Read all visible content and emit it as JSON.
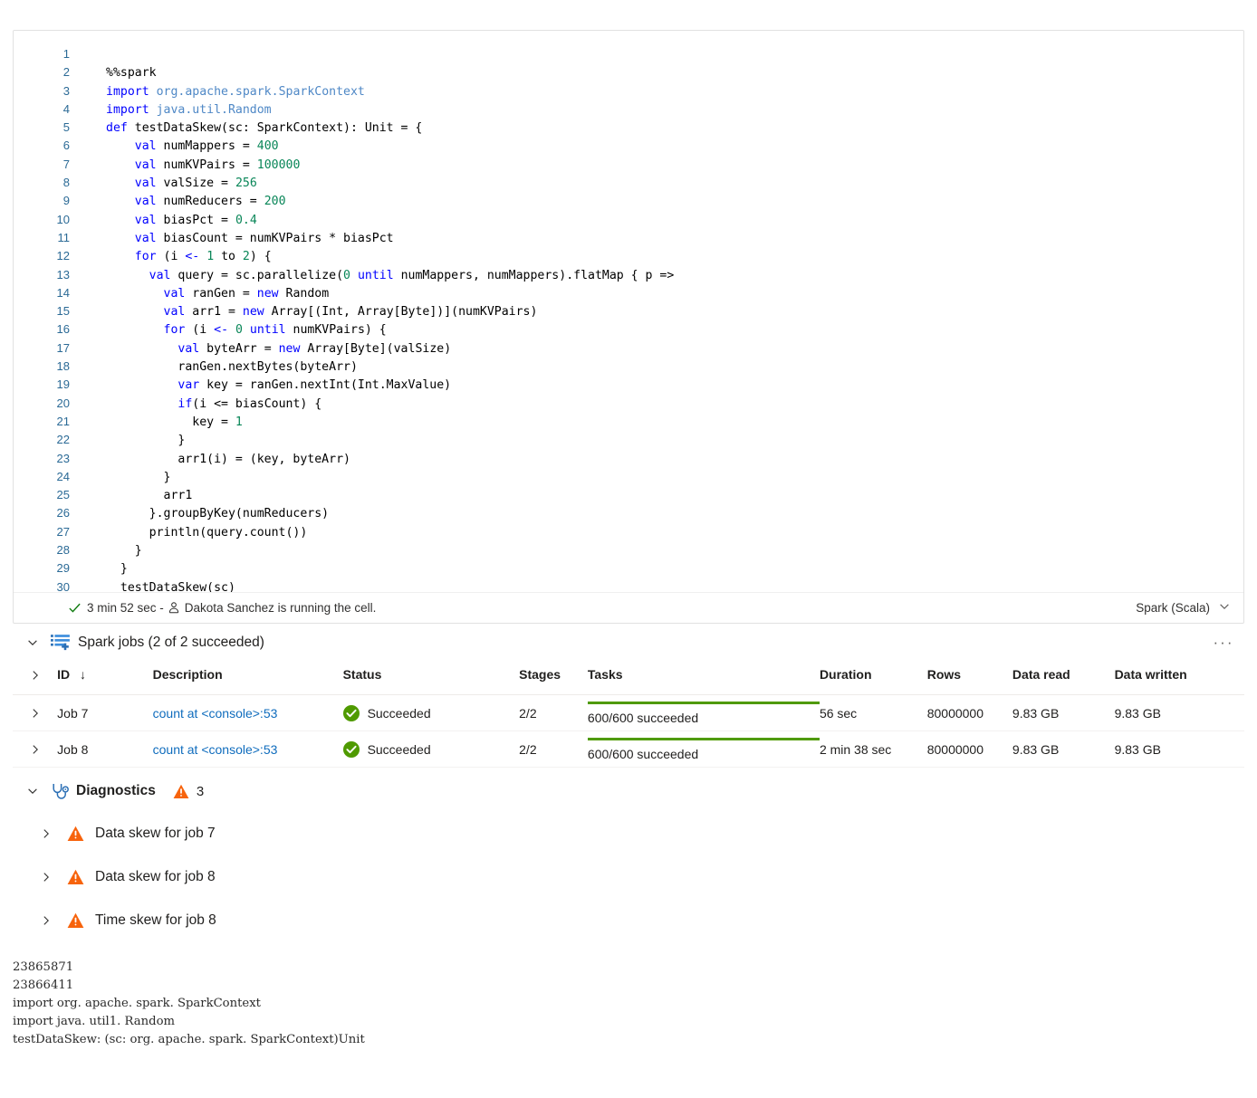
{
  "cell": {
    "code_lines": [
      {
        "n": "1",
        "tokens": []
      },
      {
        "n": "2",
        "tokens": [
          {
            "t": "%%spark",
            "c": "plain"
          }
        ]
      },
      {
        "n": "3",
        "tokens": [
          {
            "t": "import",
            "c": "kw"
          },
          {
            "t": " ",
            "c": "plain"
          },
          {
            "t": "org.apache.spark.SparkContext",
            "c": "pkg"
          }
        ]
      },
      {
        "n": "4",
        "tokens": [
          {
            "t": "import",
            "c": "kw"
          },
          {
            "t": " ",
            "c": "plain"
          },
          {
            "t": "java.util.Random",
            "c": "pkg"
          }
        ]
      },
      {
        "n": "5",
        "tokens": [
          {
            "t": "def",
            "c": "kw"
          },
          {
            "t": " testDataSkew(sc: SparkContext): Unit = {",
            "c": "plain"
          }
        ]
      },
      {
        "n": "6",
        "tokens": [
          {
            "t": "    ",
            "c": "plain"
          },
          {
            "t": "val",
            "c": "kw"
          },
          {
            "t": " numMappers = ",
            "c": "plain"
          },
          {
            "t": "400",
            "c": "num"
          }
        ]
      },
      {
        "n": "7",
        "tokens": [
          {
            "t": "    ",
            "c": "plain"
          },
          {
            "t": "val",
            "c": "kw"
          },
          {
            "t": " numKVPairs = ",
            "c": "plain"
          },
          {
            "t": "100000",
            "c": "num"
          }
        ]
      },
      {
        "n": "8",
        "tokens": [
          {
            "t": "    ",
            "c": "plain"
          },
          {
            "t": "val",
            "c": "kw"
          },
          {
            "t": " valSize = ",
            "c": "plain"
          },
          {
            "t": "256",
            "c": "num"
          }
        ]
      },
      {
        "n": "9",
        "tokens": [
          {
            "t": "    ",
            "c": "plain"
          },
          {
            "t": "val",
            "c": "kw"
          },
          {
            "t": " numReducers = ",
            "c": "plain"
          },
          {
            "t": "200",
            "c": "num"
          }
        ]
      },
      {
        "n": "10",
        "tokens": [
          {
            "t": "    ",
            "c": "plain"
          },
          {
            "t": "val",
            "c": "kw"
          },
          {
            "t": " biasPct = ",
            "c": "plain"
          },
          {
            "t": "0.4",
            "c": "num"
          }
        ]
      },
      {
        "n": "11",
        "tokens": [
          {
            "t": "    ",
            "c": "plain"
          },
          {
            "t": "val",
            "c": "kw"
          },
          {
            "t": " biasCount = numKVPairs * biasPct",
            "c": "plain"
          }
        ]
      },
      {
        "n": "12",
        "tokens": [
          {
            "t": "    ",
            "c": "plain"
          },
          {
            "t": "for",
            "c": "kw"
          },
          {
            "t": " (i ",
            "c": "plain"
          },
          {
            "t": "<-",
            "c": "kw"
          },
          {
            "t": " ",
            "c": "plain"
          },
          {
            "t": "1",
            "c": "num"
          },
          {
            "t": " to ",
            "c": "plain"
          },
          {
            "t": "2",
            "c": "num"
          },
          {
            "t": ") {",
            "c": "plain"
          }
        ]
      },
      {
        "n": "13",
        "tokens": [
          {
            "t": "      ",
            "c": "plain"
          },
          {
            "t": "val",
            "c": "kw"
          },
          {
            "t": " query = sc.parallelize(",
            "c": "plain"
          },
          {
            "t": "0",
            "c": "num"
          },
          {
            "t": " ",
            "c": "plain"
          },
          {
            "t": "until",
            "c": "kw"
          },
          {
            "t": " numMappers, numMappers).flatMap { p =>",
            "c": "plain"
          }
        ]
      },
      {
        "n": "14",
        "tokens": [
          {
            "t": "        ",
            "c": "plain"
          },
          {
            "t": "val",
            "c": "kw"
          },
          {
            "t": " ranGen = ",
            "c": "plain"
          },
          {
            "t": "new",
            "c": "kw"
          },
          {
            "t": " Random",
            "c": "plain"
          }
        ]
      },
      {
        "n": "15",
        "tokens": [
          {
            "t": "        ",
            "c": "plain"
          },
          {
            "t": "val",
            "c": "kw"
          },
          {
            "t": " arr1 = ",
            "c": "plain"
          },
          {
            "t": "new",
            "c": "kw"
          },
          {
            "t": " Array[(Int, Array[Byte])](numKVPairs)",
            "c": "plain"
          }
        ]
      },
      {
        "n": "16",
        "tokens": [
          {
            "t": "        ",
            "c": "plain"
          },
          {
            "t": "for",
            "c": "kw"
          },
          {
            "t": " (i ",
            "c": "plain"
          },
          {
            "t": "<-",
            "c": "kw"
          },
          {
            "t": " ",
            "c": "plain"
          },
          {
            "t": "0",
            "c": "num"
          },
          {
            "t": " ",
            "c": "plain"
          },
          {
            "t": "until",
            "c": "kw"
          },
          {
            "t": " numKVPairs) {",
            "c": "plain"
          }
        ]
      },
      {
        "n": "17",
        "tokens": [
          {
            "t": "          ",
            "c": "plain"
          },
          {
            "t": "val",
            "c": "kw"
          },
          {
            "t": " byteArr = ",
            "c": "plain"
          },
          {
            "t": "new",
            "c": "kw"
          },
          {
            "t": " Array[Byte](valSize)",
            "c": "plain"
          }
        ]
      },
      {
        "n": "18",
        "tokens": [
          {
            "t": "          ranGen.nextBytes(byteArr)",
            "c": "plain"
          }
        ]
      },
      {
        "n": "19",
        "tokens": [
          {
            "t": "          ",
            "c": "plain"
          },
          {
            "t": "var",
            "c": "kw"
          },
          {
            "t": " key = ranGen.nextInt(Int.MaxValue)",
            "c": "plain"
          }
        ]
      },
      {
        "n": "20",
        "tokens": [
          {
            "t": "          ",
            "c": "plain"
          },
          {
            "t": "if",
            "c": "kw"
          },
          {
            "t": "(i <= biasCount) {",
            "c": "plain"
          }
        ]
      },
      {
        "n": "21",
        "tokens": [
          {
            "t": "            key = ",
            "c": "plain"
          },
          {
            "t": "1",
            "c": "num"
          }
        ]
      },
      {
        "n": "22",
        "tokens": [
          {
            "t": "          }",
            "c": "plain"
          }
        ]
      },
      {
        "n": "23",
        "tokens": [
          {
            "t": "          arr1(i) = (key, byteArr)",
            "c": "plain"
          }
        ]
      },
      {
        "n": "24",
        "tokens": [
          {
            "t": "        }",
            "c": "plain"
          }
        ]
      },
      {
        "n": "25",
        "tokens": [
          {
            "t": "        arr1",
            "c": "plain"
          }
        ]
      },
      {
        "n": "26",
        "tokens": [
          {
            "t": "      }.groupByKey(numReducers)",
            "c": "plain"
          }
        ]
      },
      {
        "n": "27",
        "tokens": [
          {
            "t": "      println(query.count())",
            "c": "plain"
          }
        ]
      },
      {
        "n": "28",
        "tokens": [
          {
            "t": "    }",
            "c": "plain"
          }
        ]
      },
      {
        "n": "29",
        "tokens": [
          {
            "t": "  }",
            "c": "plain"
          }
        ]
      },
      {
        "n": "30",
        "tokens": [
          {
            "t": "  testDataSkew(sc)",
            "c": "plain"
          }
        ]
      }
    ],
    "status": {
      "duration": "3 min 52 sec -",
      "running_text": "Dakota Sanchez is running the cell.",
      "language": "Spark (Scala)"
    }
  },
  "spark_jobs": {
    "title": "Spark jobs (2 of 2 succeeded)",
    "ellipsis": "···",
    "columns": [
      "ID",
      "Description",
      "Status",
      "Stages",
      "Tasks",
      "Duration",
      "Rows",
      "Data read",
      "Data written"
    ],
    "sort_arrow": "↓",
    "rows": [
      {
        "id": "Job 7",
        "description": "count at <console>:53",
        "status": "Succeeded",
        "stages": "2/2",
        "tasks": "600/600 succeeded",
        "tasks_pct": 100,
        "duration": "56 sec",
        "rows": "80000000",
        "data_read": "9.83 GB",
        "data_written": "9.83 GB"
      },
      {
        "id": "Job 8",
        "description": "count at <console>:53",
        "status": "Succeeded",
        "stages": "2/2",
        "tasks": "600/600 succeeded",
        "tasks_pct": 100,
        "duration": "2 min 38 sec",
        "rows": "80000000",
        "data_read": "9.83 GB",
        "data_written": "9.83 GB"
      }
    ]
  },
  "diagnostics": {
    "title": "Diagnostics",
    "count": "3",
    "items": [
      {
        "label": "Data skew for job 7"
      },
      {
        "label": "Data skew for job 8"
      },
      {
        "label": "Time skew for job 8"
      }
    ]
  },
  "console_output": "23865871\n23866411\nimport org. apache. spark. SparkContext\nimport java. util1. Random\ntestDataSkew: (sc: org. apache. spark. SparkContext)Unit",
  "colors": {
    "link": "#0f6cbd",
    "success_green": "#4f9a00",
    "warning_orange": "#f7630c",
    "accent_blue": "#2b6a96",
    "keyword_blue": "#0000ff",
    "number_teal": "#098658"
  }
}
